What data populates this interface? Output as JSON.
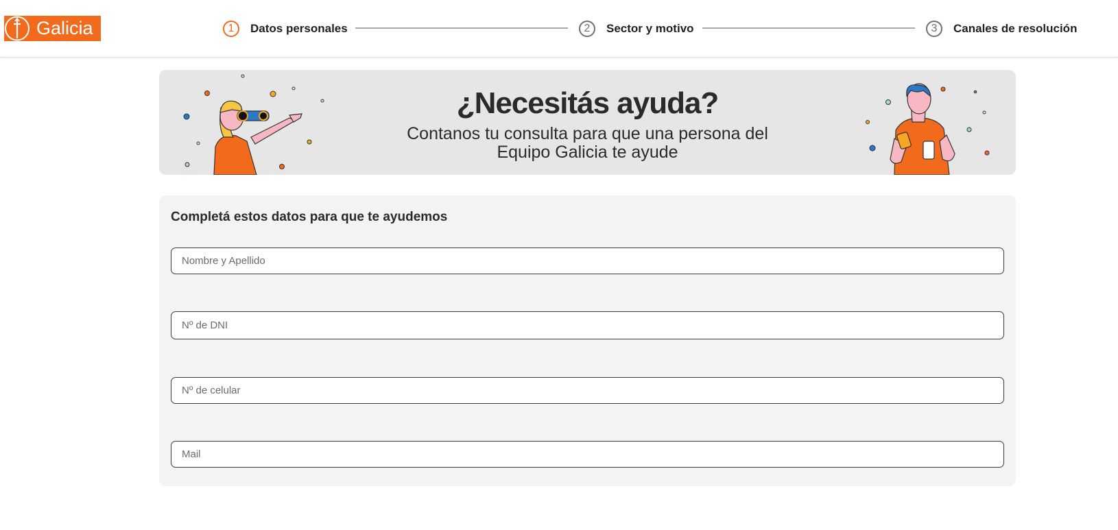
{
  "brand": {
    "name": "Galicia",
    "accent_color": "#f26b1d"
  },
  "stepper": {
    "steps": [
      {
        "number": "1",
        "label": "Datos personales",
        "state": "active"
      },
      {
        "number": "2",
        "label": "Sector y motivo",
        "state": "pending"
      },
      {
        "number": "3",
        "label": "Canales de resolución",
        "state": "pending"
      }
    ]
  },
  "banner": {
    "title": "¿Necesitás ayuda?",
    "subtitle": "Contanos tu consulta para que una persona del Equipo Galicia te ayude"
  },
  "form": {
    "title": "Completá estos datos para que te ayudemos",
    "fields": {
      "name": {
        "placeholder": "Nombre y Apellido",
        "value": ""
      },
      "dni": {
        "placeholder": "Nº de DNI",
        "value": ""
      },
      "phone": {
        "placeholder": "Nº de celular",
        "value": ""
      },
      "mail": {
        "placeholder": "Mail",
        "value": ""
      }
    }
  }
}
